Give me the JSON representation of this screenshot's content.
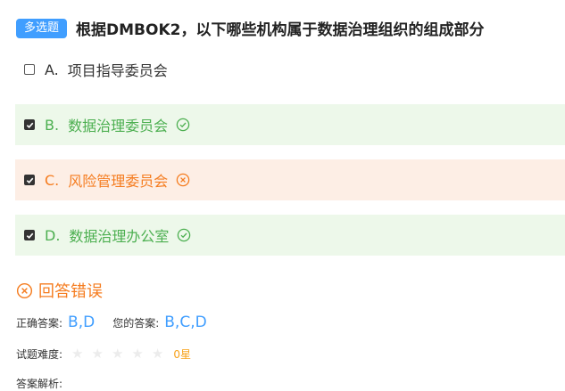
{
  "question": {
    "type_badge": "多选题",
    "title": "根据DMBOK2，以下哪些机构属于数据治理组织的组成部分"
  },
  "options": [
    {
      "letter": "A.",
      "text": "项目指导委员会",
      "checked": false,
      "status": "none"
    },
    {
      "letter": "B.",
      "text": "数据治理委员会",
      "checked": true,
      "status": "correct"
    },
    {
      "letter": "C.",
      "text": "风险管理委员会",
      "checked": true,
      "status": "wrong"
    },
    {
      "letter": "D.",
      "text": "数据治理办公室",
      "checked": true,
      "status": "correct"
    }
  ],
  "result": {
    "text": "回答错误",
    "icon": "circle-x-icon"
  },
  "answer_info": {
    "correct_label": "正确答案:",
    "correct_value": "B,D",
    "yours_label": "您的答案:",
    "yours_value": "B,C,D",
    "difficulty_label": "试题难度:",
    "difficulty_stars_filled": 0,
    "difficulty_stars_total": 5,
    "difficulty_text": "0星",
    "analysis_label": "答案解析:"
  },
  "colors": {
    "badge": "#409eff",
    "correct": "#4caf50",
    "correct_bg": "#edf8ea",
    "wrong": "#f57c1f",
    "wrong_bg": "#fdeee5",
    "answer": "#409eff",
    "rating": "#f7a21b"
  }
}
